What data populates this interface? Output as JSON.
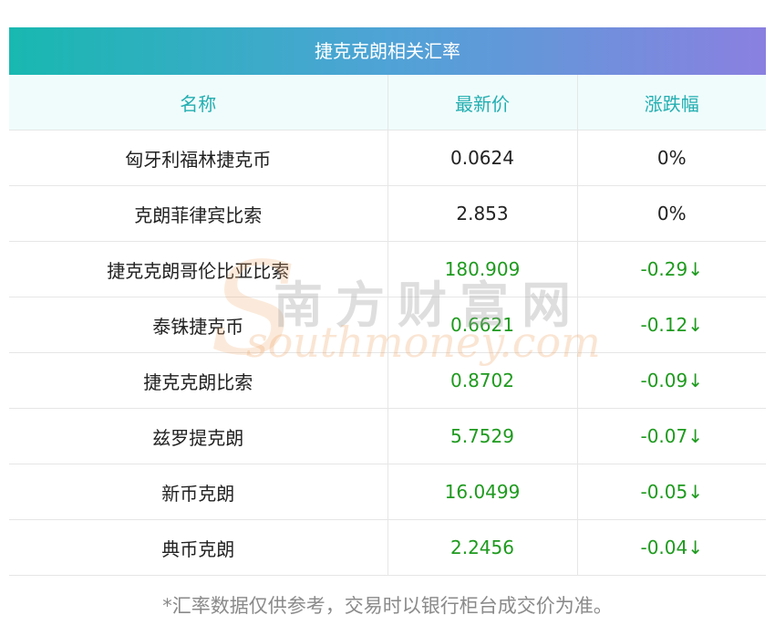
{
  "title": "捷克克朗相关汇率",
  "headers": {
    "name": "名称",
    "price": "最新价",
    "change": "涨跌幅"
  },
  "rows": [
    {
      "name": "匈牙利福林捷克币",
      "price": "0.0624",
      "change": "0%",
      "trend": "flat"
    },
    {
      "name": "克朗菲律宾比索",
      "price": "2.853",
      "change": "0%",
      "trend": "flat"
    },
    {
      "name": "捷克克朗哥伦比亚比索",
      "price": "180.909",
      "change": "-0.29↓",
      "trend": "down"
    },
    {
      "name": "泰铢捷克币",
      "price": "0.6621",
      "change": "-0.12↓",
      "trend": "down"
    },
    {
      "name": "捷克克朗比索",
      "price": "0.8702",
      "change": "-0.09↓",
      "trend": "down"
    },
    {
      "name": "兹罗提克朗",
      "price": "5.7529",
      "change": "-0.07↓",
      "trend": "down"
    },
    {
      "name": "新币克朗",
      "price": "16.0499",
      "change": "-0.05↓",
      "trend": "down"
    },
    {
      "name": "典币克朗",
      "price": "2.2456",
      "change": "-0.04↓",
      "trend": "down"
    }
  ],
  "footnote": "*汇率数据仅供参考，交易时以银行柜台成交价为准。",
  "watermark": {
    "cn": "南方财富网",
    "en": "southmoney.com",
    "s_letter": "S"
  },
  "colors": {
    "header_text": "#23aeb1",
    "down": "#1e9a1e",
    "title_gradient_start": "#18b8b0",
    "title_gradient_end": "#8a80e0"
  }
}
